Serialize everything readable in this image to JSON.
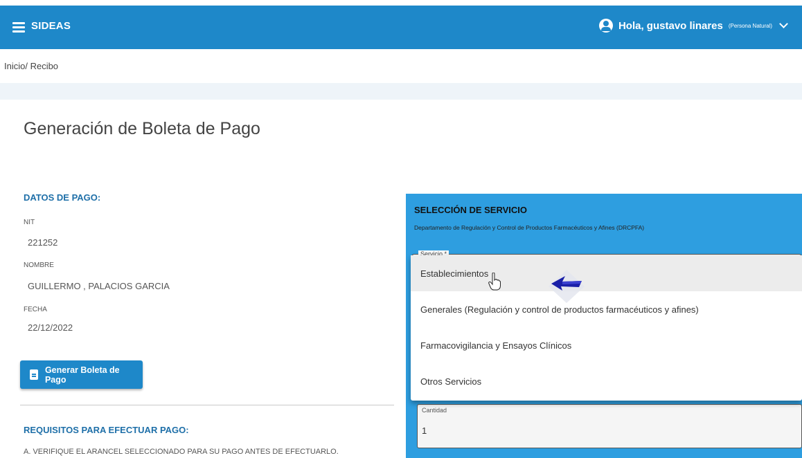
{
  "header": {
    "app_title": "SIDEAS",
    "greeting": "Hola, gustavo linares",
    "user_type": "(Persona Natural)"
  },
  "breadcrumb": "Inicio/ Recibo",
  "page_title": "Generación de Boleta de Pago",
  "payment_data": {
    "section_title": "DATOS DE PAGO:",
    "nit_label": "NIT",
    "nit_value": "221252",
    "name_label": "NOMBRE",
    "name_value": "GUILLERMO , PALACIOS GARCIA",
    "date_label": "FECHA",
    "date_value": "22/12/2022",
    "generate_button": "Generar Boleta de Pago"
  },
  "requirements": {
    "section_title": "REQUISITOS PARA EFECTUAR PAGO:",
    "item_a": "A. VERIFIQUE EL ARANCEL SELECCIONADO PARA SU PAGO ANTES DE EFECTUARLO."
  },
  "service_selection": {
    "title": "SELECCIÓN DE SERVICIO",
    "subtitle": "Departamento de Regulación y Control de Productos Farmacéuticos y Afines (DRCPFA)",
    "service_label": "Servicio *",
    "options": [
      "Establecimientos",
      "Generales (Regulación y control de productos farmacéuticos y afines)",
      "Farmacovigilancia y Ensayos Clínicos",
      "Otros Servicios"
    ],
    "quantity_label": "Cantidad",
    "quantity_value": "1"
  },
  "colors": {
    "brand_blue": "#1e88c9",
    "panel_blue": "#2e9ee0",
    "section_title": "#1e6fa8"
  }
}
